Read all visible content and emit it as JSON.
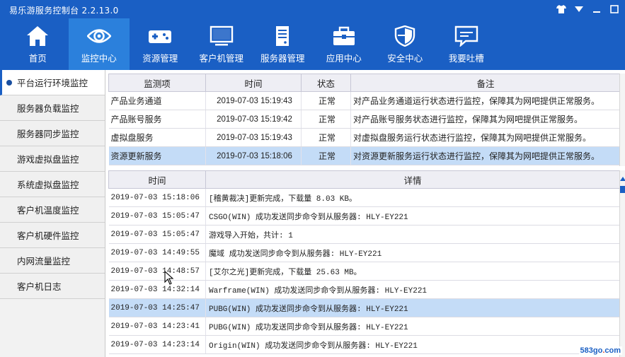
{
  "app": {
    "title": "易乐游服务控制台 2.2.13.0",
    "accent_color": "#1a5fc4",
    "active_tab_color": "#2b80dc",
    "selected_row_color": "#c4dcf7"
  },
  "window_controls": [
    {
      "name": "skin-icon"
    },
    {
      "name": "menu-dropdown-icon"
    },
    {
      "name": "minimize-icon"
    },
    {
      "name": "maximize-icon"
    }
  ],
  "nav": {
    "items": [
      {
        "label": "首页",
        "icon": "home-icon",
        "active": false
      },
      {
        "label": "监控中心",
        "icon": "eye-icon",
        "active": true
      },
      {
        "label": "资源管理",
        "icon": "gamepad-icon",
        "active": false
      },
      {
        "label": "客户机管理",
        "icon": "monitor-icon",
        "active": false
      },
      {
        "label": "服务器管理",
        "icon": "server-icon",
        "active": false
      },
      {
        "label": "应用中心",
        "icon": "toolbox-icon",
        "active": false
      },
      {
        "label": "安全中心",
        "icon": "shield-icon",
        "active": false
      },
      {
        "label": "我要吐槽",
        "icon": "feedback-icon",
        "active": false
      }
    ]
  },
  "sidebar": {
    "items": [
      {
        "label": "平台运行环境监控",
        "active": true
      },
      {
        "label": "服务器负载监控",
        "active": false
      },
      {
        "label": "服务器同步监控",
        "active": false
      },
      {
        "label": "游戏虚拟盘监控",
        "active": false
      },
      {
        "label": "系统虚拟盘监控",
        "active": false
      },
      {
        "label": "客户机温度监控",
        "active": false
      },
      {
        "label": "客户机硬件监控",
        "active": false
      },
      {
        "label": "内网流量监控",
        "active": false
      },
      {
        "label": "客户机日志",
        "active": false
      }
    ]
  },
  "monitor_table": {
    "columns": [
      "监测项",
      "时间",
      "状态",
      "备注"
    ],
    "rows": [
      {
        "item": "产品业务通道",
        "time": "2019-07-03 15:19:43",
        "status": "正常",
        "note": "对产品业务通道运行状态进行监控，保障其为网吧提供正常服务。",
        "selected": false
      },
      {
        "item": "产品账号服务",
        "time": "2019-07-03 15:19:42",
        "status": "正常",
        "note": "对产品账号服务状态进行监控，保障其为网吧提供正常服务。",
        "selected": false
      },
      {
        "item": "虚拟盘服务",
        "time": "2019-07-03 15:19:43",
        "status": "正常",
        "note": "对虚拟盘服务运行状态进行监控，保障其为网吧提供正常服务。",
        "selected": false
      },
      {
        "item": "资源更新服务",
        "time": "2019-07-03 15:18:06",
        "status": "正常",
        "note": "对资源更新服务运行状态进行监控，保障其为网吧提供正常服务。",
        "selected": true
      }
    ]
  },
  "log_table": {
    "columns": [
      "时间",
      "详情"
    ],
    "rows": [
      {
        "time": "2019-07-03 15:18:06",
        "detail": "[稽黄裁决]更新完成，下载量 8.03 KB。",
        "selected": false
      },
      {
        "time": "2019-07-03 15:05:47",
        "detail": "CSGO(WIN) 成功发送同步命令到从服务器: HLY-EY221",
        "selected": false
      },
      {
        "time": "2019-07-03 15:05:47",
        "detail": "游戏导入开始，共计: 1",
        "selected": false
      },
      {
        "time": "2019-07-03 14:49:55",
        "detail": "魔域 成功发送同步命令到从服务器: HLY-EY221",
        "selected": false
      },
      {
        "time": "2019-07-03 14:48:57",
        "detail": "[艾尔之光]更新完成，下载量 25.63 MB。",
        "selected": false
      },
      {
        "time": "2019-07-03 14:32:14",
        "detail": "Warframe(WIN) 成功发送同步命令到从服务器: HLY-EY221",
        "selected": false
      },
      {
        "time": "2019-07-03 14:25:47",
        "detail": "PUBG(WIN) 成功发送同步命令到从服务器: HLY-EY221",
        "selected": true
      },
      {
        "time": "2019-07-03 14:23:41",
        "detail": "PUBG(WIN) 成功发送同步命令到从服务器: HLY-EY221",
        "selected": false
      },
      {
        "time": "2019-07-03 14:23:14",
        "detail": "Origin(WIN) 成功发送同步命令到从服务器: HLY-EY221",
        "selected": false
      }
    ]
  },
  "watermark": {
    "main": "583go",
    "dot": ".",
    "tld": "com"
  }
}
